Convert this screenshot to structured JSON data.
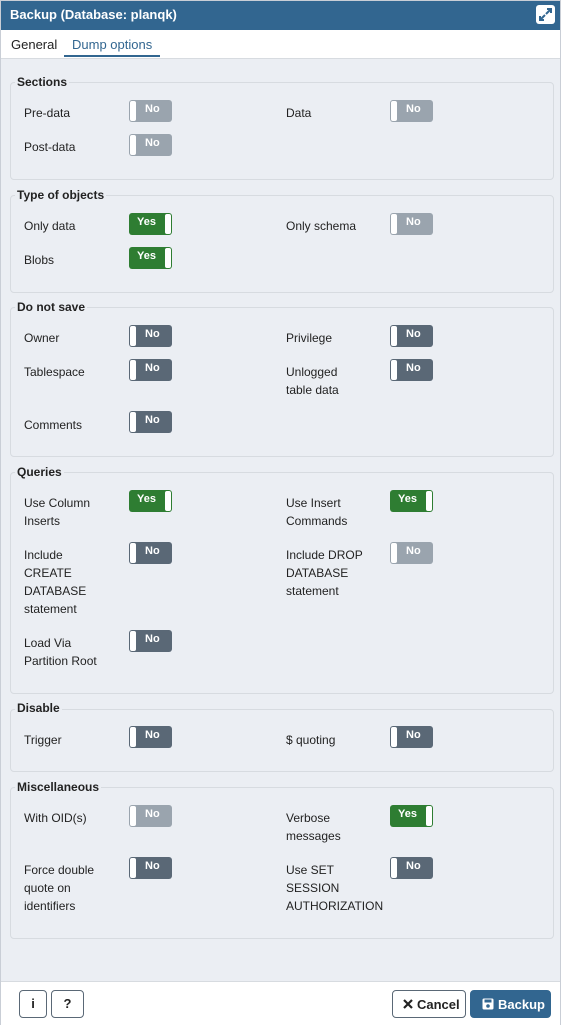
{
  "window": {
    "title": "Backup (Database: planqk)",
    "expand_icon": "expand-icon"
  },
  "tabs": [
    {
      "label": "General",
      "active": false
    },
    {
      "label": "Dump options",
      "active": true
    }
  ],
  "sections": {
    "sections": {
      "legend": "Sections",
      "items": {
        "pre_data": {
          "label": "Pre-data",
          "value": "No",
          "disabled": true
        },
        "data": {
          "label": "Data",
          "value": "No",
          "disabled": true
        },
        "post_data": {
          "label": "Post-data",
          "value": "No",
          "disabled": true
        }
      }
    },
    "type_of_objects": {
      "legend": "Type of objects",
      "items": {
        "only_data": {
          "label": "Only data",
          "value": "Yes"
        },
        "only_schema": {
          "label": "Only schema",
          "value": "No",
          "disabled": true
        },
        "blobs": {
          "label": "Blobs",
          "value": "Yes"
        }
      }
    },
    "do_not_save": {
      "legend": "Do not save",
      "items": {
        "owner": {
          "label": "Owner",
          "value": "No"
        },
        "privilege": {
          "label": "Privilege",
          "value": "No"
        },
        "tablespace": {
          "label": "Tablespace",
          "value": "No"
        },
        "unlogged": {
          "label": "Unlogged\ntable data",
          "value": "No"
        },
        "comments": {
          "label": "Comments",
          "value": "No"
        }
      }
    },
    "queries": {
      "legend": "Queries",
      "items": {
        "use_column_inserts": {
          "label": "Use Column\nInserts",
          "value": "Yes"
        },
        "use_insert_commands": {
          "label": "Use Insert\nCommands",
          "value": "Yes"
        },
        "include_create_db": {
          "label": "Include\nCREATE\nDATABASE\nstatement",
          "value": "No"
        },
        "include_drop_db": {
          "label": "Include DROP\nDATABASE\nstatement",
          "value": "No",
          "disabled": true
        },
        "load_via_partition_root": {
          "label": "Load Via\nPartition Root",
          "value": "No"
        }
      }
    },
    "disable": {
      "legend": "Disable",
      "items": {
        "trigger": {
          "label": "Trigger",
          "value": "No"
        },
        "quoting": {
          "label": "$ quoting",
          "value": "No"
        }
      }
    },
    "miscellaneous": {
      "legend": "Miscellaneous",
      "items": {
        "with_oids": {
          "label": "With OID(s)",
          "value": "No",
          "disabled": true
        },
        "verbose_messages": {
          "label": "Verbose\nmessages",
          "value": "Yes"
        },
        "force_double_quote": {
          "label": "Force double\nquote on\nidentifiers",
          "value": "No"
        },
        "use_set_session_auth": {
          "label": "Use SET\nSESSION\nAUTHORIZATION",
          "value": "No"
        }
      }
    }
  },
  "footer": {
    "info_icon": "info-icon",
    "info_label": "i",
    "help_label": "?",
    "cancel_label": "Cancel",
    "backup_label": "Backup"
  },
  "colors": {
    "header": "#326690",
    "toggle_yes": "#2e7d32",
    "toggle_no": "#5a6876",
    "toggle_disabled": "#9aa4ae"
  }
}
